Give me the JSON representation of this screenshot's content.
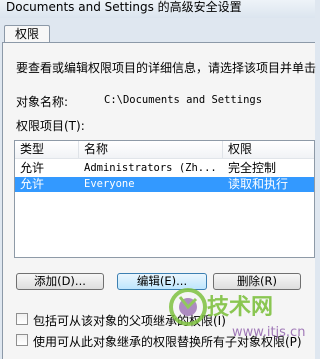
{
  "window": {
    "title": "Documents and Settings 的高级安全设置"
  },
  "tabs": [
    {
      "label": "权限"
    }
  ],
  "content": {
    "instruction": "要查看或编辑权限项目的详细信息，请选择该项目并单击",
    "object_name_label": "对象名称:",
    "object_name_value": "C:\\Documents and Settings",
    "entries_label": "权限项目(T):"
  },
  "table": {
    "columns": [
      "类型",
      "名称",
      "权限"
    ],
    "rows": [
      {
        "type": "允许",
        "name": "Administrators (Zh...",
        "permission": "完全控制",
        "selected": false
      },
      {
        "type": "允许",
        "name": "Everyone",
        "permission": "读取和执行",
        "selected": true
      }
    ]
  },
  "buttons": {
    "add": "添加(D)...",
    "edit": "编辑(E)...",
    "remove": "删除(R)"
  },
  "checkboxes": [
    {
      "label": "包括可从该对象的父项继承的权限(I)",
      "checked": false
    },
    {
      "label": "使用可从此对象继承的权限替换所有子对象权限(P)",
      "checked": false
    }
  ],
  "watermark": {
    "brand": "技术网",
    "url": "www.itjs.cn"
  },
  "colors": {
    "selection": "#3399ff",
    "watermark_green": "#7fc241",
    "watermark_purple": "#8b5aa8"
  }
}
